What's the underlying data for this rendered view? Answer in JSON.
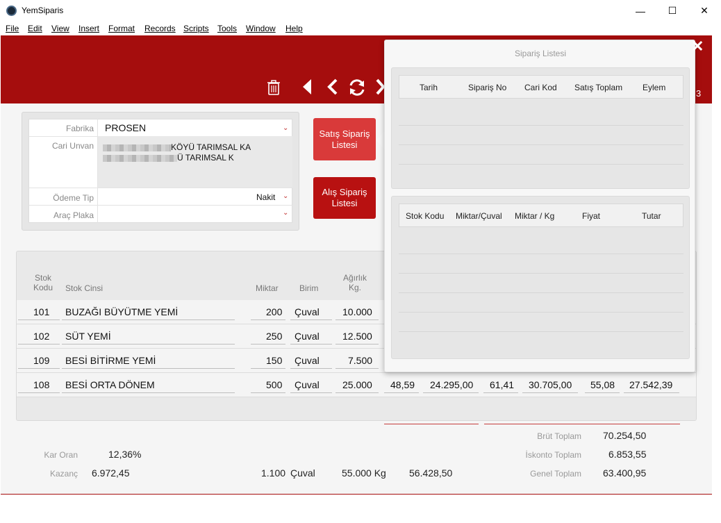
{
  "window": {
    "title": "YemSiparis",
    "minimize": "—",
    "maximize": "☐",
    "close": "✕"
  },
  "menu": [
    "File",
    "Edit",
    "View",
    "Insert",
    "Format",
    "Records",
    "Scripts",
    "Tools",
    "Window",
    "Help"
  ],
  "form": {
    "fabrika_label": "Fabrika",
    "fabrika_value": "PROSEN",
    "cari_label": "Cari Unvan",
    "cari_line1": "KÖYÜ TARIMSAL KA",
    "cari_line2": "Ü TARIMSAL  K",
    "odeme_label": "Ödeme Tip",
    "odeme_value": "Nakit",
    "arac_label": "Araç Plaka"
  },
  "buttons": {
    "satis": "Satış Sipariş Listesi",
    "alis": "Alış Sipariş Listesi"
  },
  "grid": {
    "headers": {
      "stok_kodu": "Stok Kodu",
      "stok_cinsi": "Stok Cinsi",
      "miktar": "Miktar",
      "birim": "Birim",
      "agirlik": "Ağırlık Kg."
    },
    "rows": [
      {
        "kod": "101",
        "cins": "BUZAĞI BÜYÜTME YEMİ",
        "miktar": "200",
        "birim": "Çuval",
        "agirlik": "10.000"
      },
      {
        "kod": "102",
        "cins": "SÜT YEMİ",
        "miktar": "250",
        "birim": "Çuval",
        "agirlik": "12.500"
      },
      {
        "kod": "109",
        "cins": "BESİ BİTİRME YEMİ",
        "miktar": "150",
        "birim": "Çuval",
        "agirlik": "7.500"
      },
      {
        "kod": "108",
        "cins": "BESİ ORTA DÖNEM",
        "miktar": "500",
        "birim": "Çuval",
        "agirlik": "25.000",
        "c1": "48,59",
        "c2": "24.295,00",
        "c3": "61,41",
        "c4": "30.705,00",
        "c5": "55,08",
        "c6": "27.542,39"
      }
    ]
  },
  "totals": {
    "brut_label": "Brüt Toplam",
    "brut_value": "70.254,50",
    "iskonto_label": "İskonto Toplam",
    "iskonto_value": "6.853,55",
    "genel_label": "Genel Toplam",
    "genel_value": "63.400,95",
    "kar_label": "Kar Oran",
    "kar_value": "12,36%",
    "kazanc_label": "Kazanç",
    "kazanc_value": "6.972,45",
    "sum_miktar": "1.100",
    "sum_birim": "Çuval",
    "sum_kg": "55.000 Kg",
    "sum_other": "56.428,50"
  },
  "popup": {
    "title": "Sipariş Listesi",
    "top_headers": [
      "Tarih",
      "Sipariş No",
      "Cari Kod",
      "Satış Toplam",
      "Eylem"
    ],
    "bottom_headers": [
      "Stok Kodu",
      "Miktar/Çuval",
      "Miktar / Kg",
      "Fiyat",
      "Tutar"
    ]
  },
  "header_partial": "3",
  "colors": {
    "brand": "#a50d0d",
    "button_active": "#d93a3a",
    "button": "#b81111"
  }
}
